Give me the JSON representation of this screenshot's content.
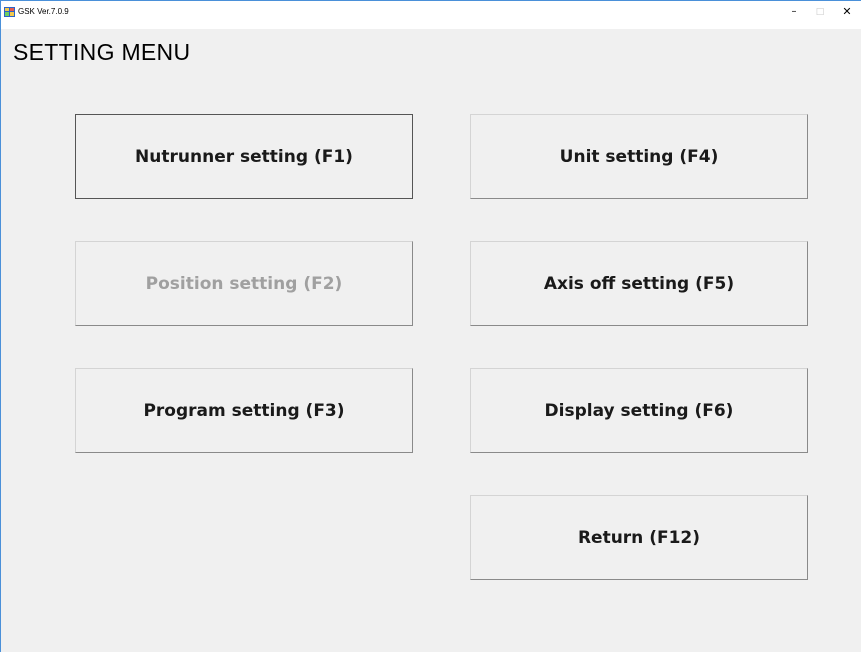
{
  "window": {
    "title": "GSK Ver.7.0.9",
    "minimize_glyph": "–",
    "maximize_glyph": "□",
    "close_glyph": "✕"
  },
  "page": {
    "title": "SETTING MENU"
  },
  "buttons": {
    "nutrunner": {
      "label": "Nutrunner setting (F1)",
      "enabled": true,
      "focused": true
    },
    "position": {
      "label": "Position setting (F2)",
      "enabled": false
    },
    "program": {
      "label": "Program setting (F3)",
      "enabled": true
    },
    "unit": {
      "label": "Unit setting (F4)",
      "enabled": true
    },
    "axis_off": {
      "label": "Axis off setting (F5)",
      "enabled": true
    },
    "display": {
      "label": "Display setting (F6)",
      "enabled": true
    },
    "return": {
      "label": "Return (F12)",
      "enabled": true
    }
  },
  "colors": {
    "background": "#f0f0f0",
    "disabled_text": "#a0a0a0",
    "window_border": "#4a90d9"
  }
}
